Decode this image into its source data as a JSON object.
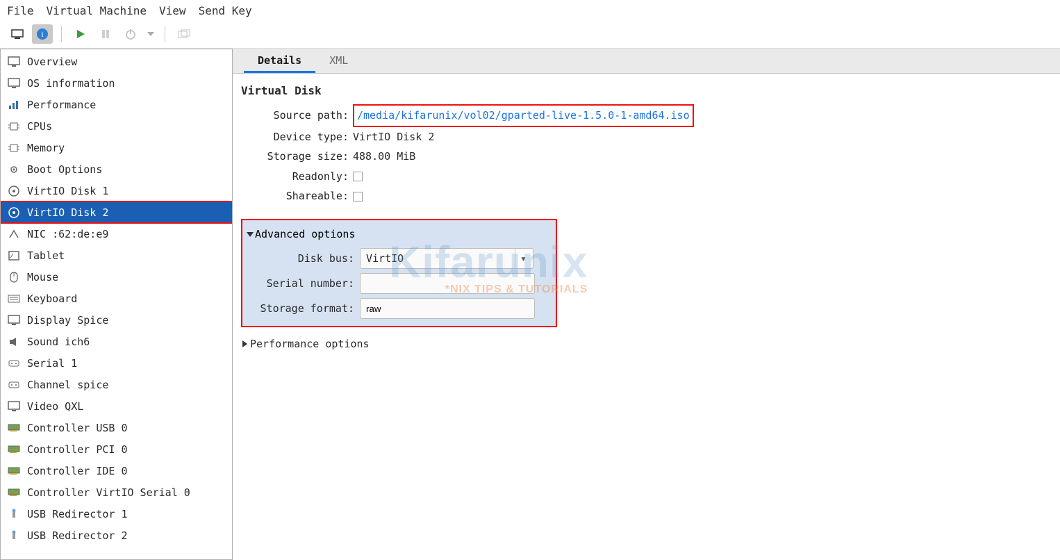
{
  "menubar": {
    "file": "File",
    "vm": "Virtual Machine",
    "view": "View",
    "sendkey": "Send Key"
  },
  "sidebar": {
    "items": [
      {
        "label": "Overview",
        "icon": "monitor"
      },
      {
        "label": "OS information",
        "icon": "monitor"
      },
      {
        "label": "Performance",
        "icon": "chart"
      },
      {
        "label": "CPUs",
        "icon": "chip"
      },
      {
        "label": "Memory",
        "icon": "chip"
      },
      {
        "label": "Boot Options",
        "icon": "gear"
      },
      {
        "label": "VirtIO Disk 1",
        "icon": "disk"
      },
      {
        "label": "VirtIO Disk 2",
        "icon": "disk",
        "selected": true,
        "highlight": true
      },
      {
        "label": "NIC :62:de:e9",
        "icon": "nic"
      },
      {
        "label": "Tablet",
        "icon": "tablet"
      },
      {
        "label": "Mouse",
        "icon": "mouse"
      },
      {
        "label": "Keyboard",
        "icon": "keyboard"
      },
      {
        "label": "Display Spice",
        "icon": "monitor"
      },
      {
        "label": "Sound ich6",
        "icon": "sound"
      },
      {
        "label": "Serial 1",
        "icon": "port"
      },
      {
        "label": "Channel spice",
        "icon": "port"
      },
      {
        "label": "Video QXL",
        "icon": "monitor"
      },
      {
        "label": "Controller USB 0",
        "icon": "card"
      },
      {
        "label": "Controller PCI 0",
        "icon": "card"
      },
      {
        "label": "Controller IDE 0",
        "icon": "card"
      },
      {
        "label": "Controller VirtIO Serial 0",
        "icon": "card"
      },
      {
        "label": "USB Redirector 1",
        "icon": "usb"
      },
      {
        "label": "USB Redirector 2",
        "icon": "usb"
      }
    ]
  },
  "tabs": {
    "details": "Details",
    "xml": "XML"
  },
  "panel": {
    "heading": "Virtual Disk",
    "source_path_label": "Source path:",
    "source_path_value": "/media/kifarunix/vol02/gparted-live-1.5.0-1-amd64.iso",
    "device_type_label": "Device type:",
    "device_type_value": "VirtIO Disk 2",
    "storage_size_label": "Storage size:",
    "storage_size_value": "488.00 MiB",
    "readonly_label": "Readonly:",
    "shareable_label": "Shareable:"
  },
  "advanced": {
    "title": "Advanced options",
    "disk_bus_label": "Disk bus:",
    "disk_bus_value": "VirtIO",
    "serial_label": "Serial number:",
    "serial_value": "",
    "storage_format_label": "Storage format:",
    "storage_format_value": "raw"
  },
  "perf_options_label": "Performance options",
  "watermark": {
    "brand": "Kifarunix",
    "tagline": "*NIX TIPS & TUTORIALS"
  }
}
